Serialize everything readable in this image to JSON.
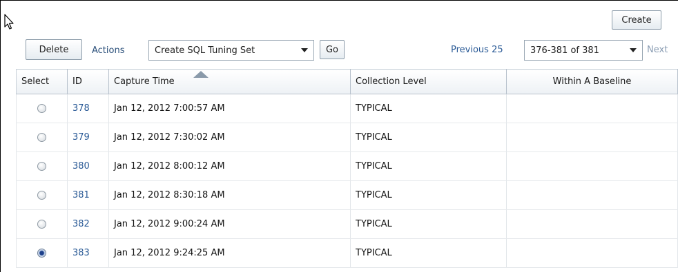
{
  "toolbar": {
    "create_label": "Create",
    "delete_label": "Delete",
    "actions_label": "Actions",
    "action_selected": "Create SQL Tuning Set",
    "go_label": "Go"
  },
  "pagination": {
    "previous_label": "Previous 25",
    "range_selected": "376-381 of 381",
    "next_label": "Next"
  },
  "table": {
    "columns": [
      "Select",
      "ID",
      "Capture Time",
      "Collection Level",
      "Within A Baseline"
    ],
    "sorted_column": "Capture Time",
    "sort_direction": "ascending",
    "rows": [
      {
        "selected": false,
        "id": "378",
        "capture_time": "Jan 12, 2012 7:00:57 AM",
        "level": "TYPICAL",
        "baseline": ""
      },
      {
        "selected": false,
        "id": "379",
        "capture_time": "Jan 12, 2012 7:30:02 AM",
        "level": "TYPICAL",
        "baseline": ""
      },
      {
        "selected": false,
        "id": "380",
        "capture_time": "Jan 12, 2012 8:00:12 AM",
        "level": "TYPICAL",
        "baseline": ""
      },
      {
        "selected": false,
        "id": "381",
        "capture_time": "Jan 12, 2012 8:30:18 AM",
        "level": "TYPICAL",
        "baseline": ""
      },
      {
        "selected": false,
        "id": "382",
        "capture_time": "Jan 12, 2012 9:00:24 AM",
        "level": "TYPICAL",
        "baseline": ""
      },
      {
        "selected": true,
        "id": "383",
        "capture_time": "Jan 12, 2012 9:24:25 AM",
        "level": "TYPICAL",
        "baseline": ""
      }
    ]
  },
  "colors": {
    "link": "#2a5a96",
    "disabled_link": "#8a9db3",
    "header_border": "#b7c1cc"
  }
}
